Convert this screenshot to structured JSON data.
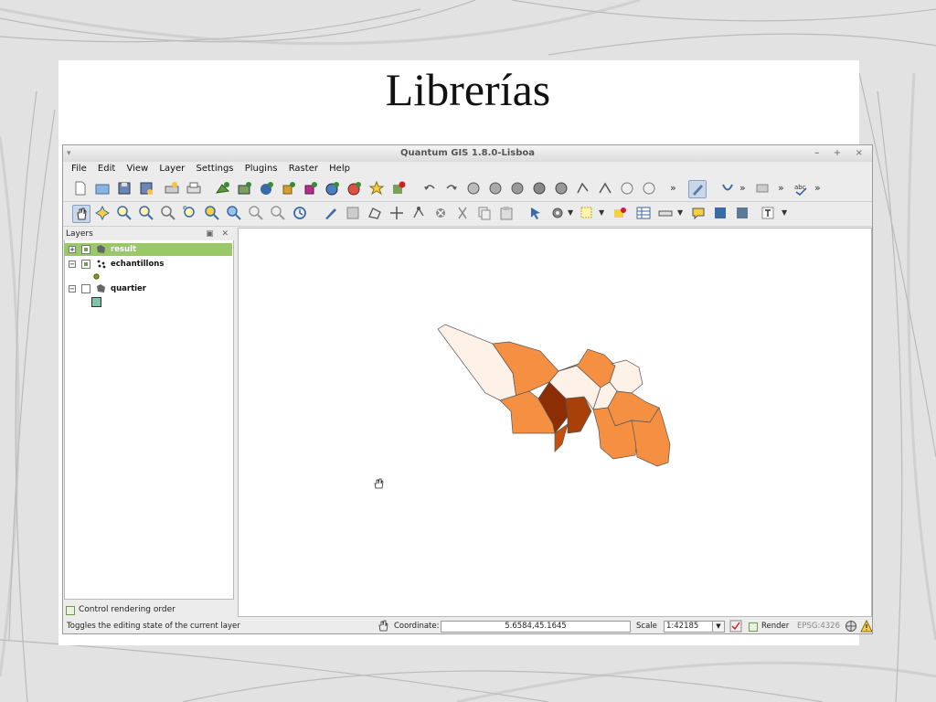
{
  "slide": {
    "title": "Librerías"
  },
  "window": {
    "title": "Quantum GIS 1.8.0-Lisboa"
  },
  "menu": [
    "File",
    "Edit",
    "View",
    "Layer",
    "Settings",
    "Plugins",
    "Raster",
    "Help"
  ],
  "toolbar": {
    "more_chevron": "»",
    "dropdown_arrow": "▼"
  },
  "layers_panel": {
    "title": "Layers",
    "items": [
      {
        "name": "result",
        "selected": true,
        "checked": true
      },
      {
        "name": "echantillons",
        "selected": false,
        "checked": true
      },
      {
        "name": "quartier",
        "selected": false,
        "checked": false
      }
    ],
    "control_rendering_order": "Control rendering order"
  },
  "map": {
    "colors": {
      "light": "#fdf1e8",
      "medium": "#f58f41",
      "dark": "#8c2d04",
      "mid_dark": "#c4500f"
    }
  },
  "statusbar": {
    "message": "Toggles the editing state of the current layer",
    "coordinate_label": "Coordinate:",
    "coordinate_value": "5.6584,45.1645",
    "scale_label": "Scale",
    "scale_value": "1:42185",
    "render_label": "Render",
    "crs": "EPSG:4326"
  }
}
